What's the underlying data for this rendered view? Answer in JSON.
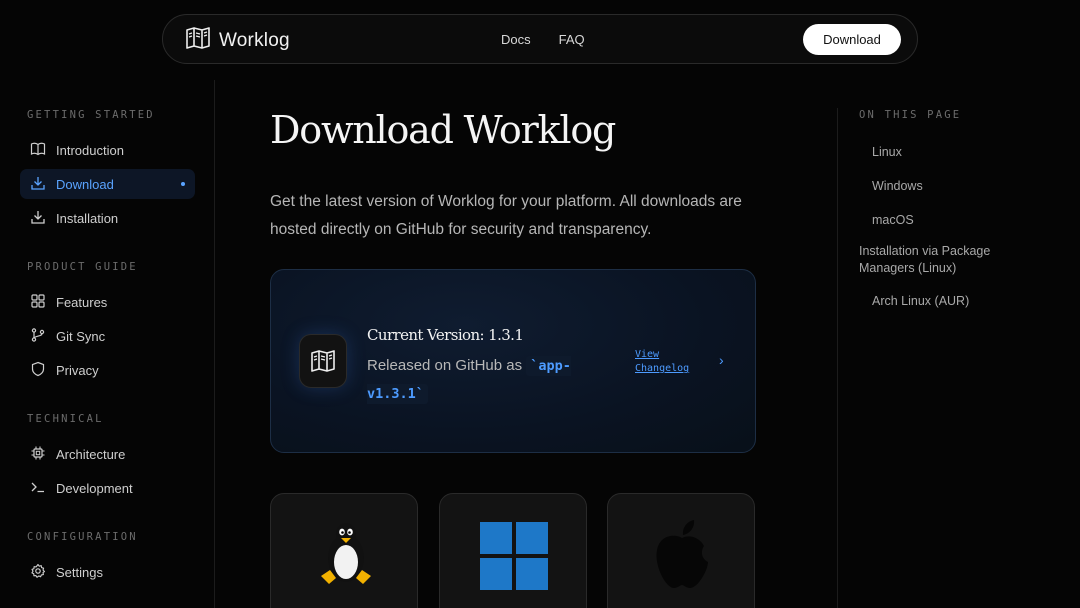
{
  "header": {
    "brand": "Worklog",
    "nav": [
      "Docs",
      "FAQ"
    ],
    "download_label": "Download"
  },
  "sidebar": {
    "sections": [
      {
        "title": "GETTING STARTED",
        "items": [
          {
            "label": "Introduction",
            "icon": "book-icon"
          },
          {
            "label": "Download",
            "icon": "download-icon",
            "active": true
          },
          {
            "label": "Installation",
            "icon": "install-icon"
          }
        ]
      },
      {
        "title": "PRODUCT GUIDE",
        "items": [
          {
            "label": "Features",
            "icon": "grid-icon"
          },
          {
            "label": "Git Sync",
            "icon": "git-branch-icon"
          },
          {
            "label": "Privacy",
            "icon": "shield-icon"
          }
        ]
      },
      {
        "title": "TECHNICAL",
        "items": [
          {
            "label": "Architecture",
            "icon": "chip-icon"
          },
          {
            "label": "Development",
            "icon": "terminal-icon"
          }
        ]
      },
      {
        "title": "CONFIGURATION",
        "items": [
          {
            "label": "Settings",
            "icon": "gear-icon"
          }
        ]
      }
    ]
  },
  "main": {
    "title": "Download Worklog",
    "lead": "Get the latest version of Worklog for your platform. All downloads are hosted directly on GitHub for security and transparency.",
    "version": {
      "title": "Current Version: 1.3.1",
      "release_prefix": "Released on GitHub as ",
      "tag": "`app-v1.3.1`",
      "changelog": "View Changelog"
    },
    "platforms": [
      {
        "name": "Linux",
        "icon": "linux-tux-icon"
      },
      {
        "name": "Windows",
        "icon": "windows-icon"
      },
      {
        "name": "macOS",
        "icon": "apple-icon"
      }
    ]
  },
  "toc": {
    "title": "ON THIS PAGE",
    "items": [
      "Linux",
      "Windows",
      "macOS",
      "Installation via Package Managers (Linux)",
      "Arch Linux (AUR)"
    ]
  },
  "colors": {
    "accent": "#4d9bff",
    "background": "#050505",
    "card_bg": "#0a1322"
  }
}
